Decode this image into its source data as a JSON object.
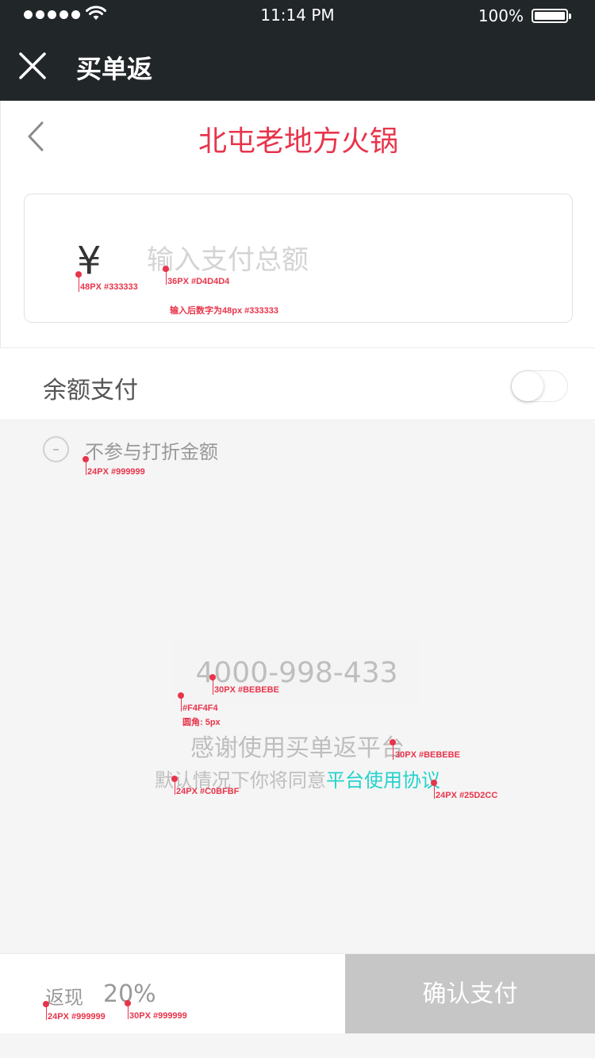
{
  "status_bar": {
    "time": "11:14 PM",
    "battery": "100%"
  },
  "header": {
    "title": "买单返"
  },
  "merchant": {
    "name": "北屯老地方火锅"
  },
  "amount": {
    "currency_symbol": "¥",
    "placeholder": "输入支付总额"
  },
  "balance": {
    "label": "余额支付",
    "enabled": false
  },
  "exclude": {
    "label": "不参与打折金额"
  },
  "info": {
    "phone": "4000-998-433",
    "thanks": "感谢使用买单返平台",
    "agree_prefix": "默认情况下你将同意",
    "agree_link": "平台使用协议"
  },
  "footer": {
    "cashback_label": "返现",
    "cashback_value": "20%",
    "confirm": "确认支付"
  },
  "annotations": {
    "yen_spec": "48PX #333333",
    "placeholder_spec": "36PX #D4D4D4",
    "input_note": "输入后数字为48px  #333333",
    "exclude_spec": "24PX #999999",
    "phone_spec": "30PX #BEBEBE",
    "box_color": "#F4F4F4",
    "box_radius": "圆角: 5px",
    "thanks_spec": "30PX #BEBEBE",
    "agree_spec": "24PX #C0BFBF",
    "link_spec": "24PX #25D2CC",
    "cashback_label_spec": "24PX #999999",
    "cashback_value_spec": "30PX #999999"
  },
  "colors": {
    "accent_red": "#e8344b",
    "link_teal": "#25d2cc",
    "header_dark": "#212629",
    "button_disabled": "#c6c6c6"
  },
  "icons": {
    "close": "close-icon",
    "back": "chevron-left-icon",
    "wifi": "wifi-icon",
    "battery": "battery-icon",
    "signal": "signal-icon"
  }
}
